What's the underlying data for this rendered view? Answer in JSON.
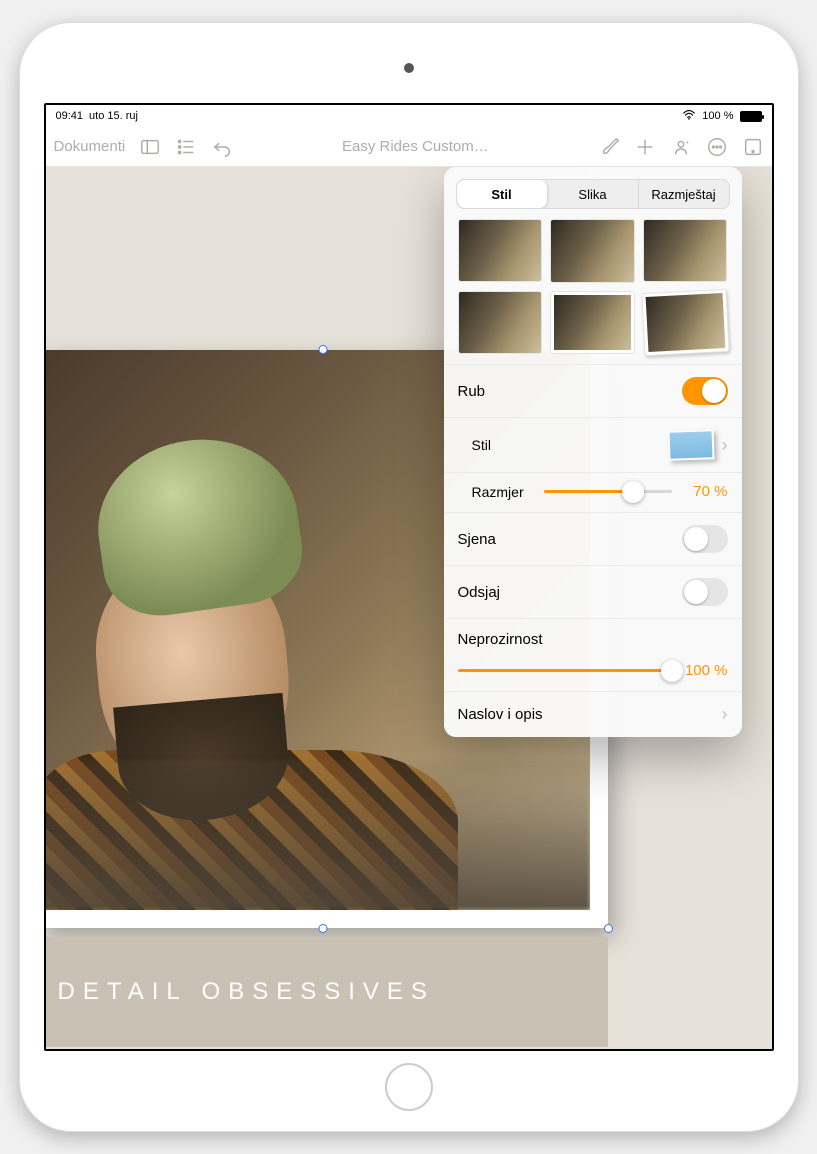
{
  "statusbar": {
    "time": "09:41",
    "date": "uto 15. ruj",
    "battery": "100 %"
  },
  "toolbar": {
    "back_label": "Dokumenti",
    "doc_title": "Easy Rides Custom…"
  },
  "canvas": {
    "caption": "DETAIL OBSESSIVES"
  },
  "popover": {
    "tabs": {
      "style": "Stil",
      "image": "Slika",
      "layout": "Razmještaj"
    },
    "border": {
      "label": "Rub",
      "on": true,
      "style_label": "Stil",
      "scale_label": "Razmjer",
      "scale_value": 70,
      "scale_text": "70 %"
    },
    "shadow": {
      "label": "Sjena",
      "on": false
    },
    "reflection": {
      "label": "Odsjaj",
      "on": false
    },
    "opacity": {
      "label": "Neprozirnost",
      "value": 100,
      "text": "100 %"
    },
    "title_desc": {
      "label": "Naslov i opis"
    }
  }
}
